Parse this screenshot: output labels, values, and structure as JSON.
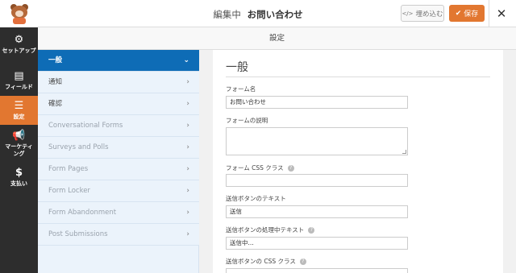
{
  "header": {
    "editing_label": "編集中",
    "form_name": "お問い合わせ",
    "embed_label": "埋め込む",
    "save_label": "保存",
    "close_symbol": "✕"
  },
  "leftnav": {
    "items": [
      {
        "label": "セットアップ",
        "icon": "gear-icon"
      },
      {
        "label": "フィールド",
        "icon": "fields-icon"
      },
      {
        "label": "設定",
        "icon": "sliders-icon"
      },
      {
        "label": "マーケティング",
        "icon": "megaphone-icon"
      },
      {
        "label": "支払い",
        "icon": "dollar-icon"
      }
    ],
    "active_index": 2
  },
  "section_header": "設定",
  "settings_sidebar": {
    "items": [
      {
        "label": "一般"
      },
      {
        "label": "通知"
      },
      {
        "label": "確認"
      },
      {
        "label": "Conversational Forms"
      },
      {
        "label": "Surveys and Polls"
      },
      {
        "label": "Form Pages"
      },
      {
        "label": "Form Locker"
      },
      {
        "label": "Form Abandonment"
      },
      {
        "label": "Post Submissions"
      }
    ],
    "active_index": 0
  },
  "panel": {
    "title": "一般",
    "fields": {
      "form_name_label": "フォーム名",
      "form_name_value": "お問い合わせ",
      "form_desc_label": "フォームの説明",
      "form_css_label": "フォーム CSS クラス",
      "submit_text_label": "送信ボタンのテキスト",
      "submit_text_value": "送信",
      "processing_text_label": "送信ボタンの処理中テキスト",
      "processing_text_value": "送信中...",
      "submit_css_label": "送信ボタンの CSS クラス"
    }
  },
  "colors": {
    "accent": "#e27730",
    "active_blue": "#0e6cb6",
    "nav_bg": "#2d2d2d"
  }
}
